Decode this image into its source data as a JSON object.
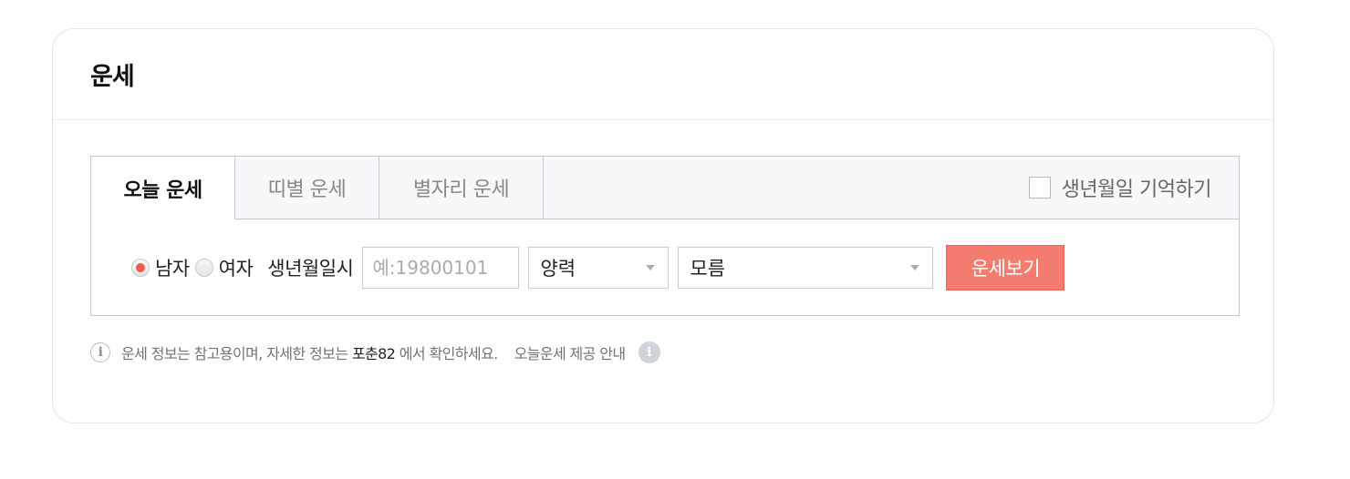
{
  "card": {
    "title": "운세"
  },
  "tabs": [
    {
      "label": "오늘 운세",
      "active": true
    },
    {
      "label": "띠별 운세",
      "active": false
    },
    {
      "label": "별자리 운세",
      "active": false
    }
  ],
  "remember": {
    "label": "생년월일 기억하기",
    "checked": false
  },
  "form": {
    "gender_options": [
      {
        "label": "남자",
        "checked": true
      },
      {
        "label": "여자",
        "checked": false
      }
    ],
    "birth_label": "생년월일시",
    "date_placeholder": "예:19800101",
    "calendar_value": "양력",
    "time_value": "모름",
    "submit_label": "운세보기"
  },
  "note": {
    "icon": "info-icon",
    "text_before": "운세 정보는 참고용이며, 자세한 정보는",
    "brand": "포춘82",
    "text_after": "에서 확인하세요.",
    "provider_label": "오늘운세 제공 안내",
    "provider_icon": "info-filled-icon"
  },
  "colors": {
    "accent": "#f47c6f",
    "radio_dot": "#f05a4a",
    "border": "#c5c9d0"
  }
}
